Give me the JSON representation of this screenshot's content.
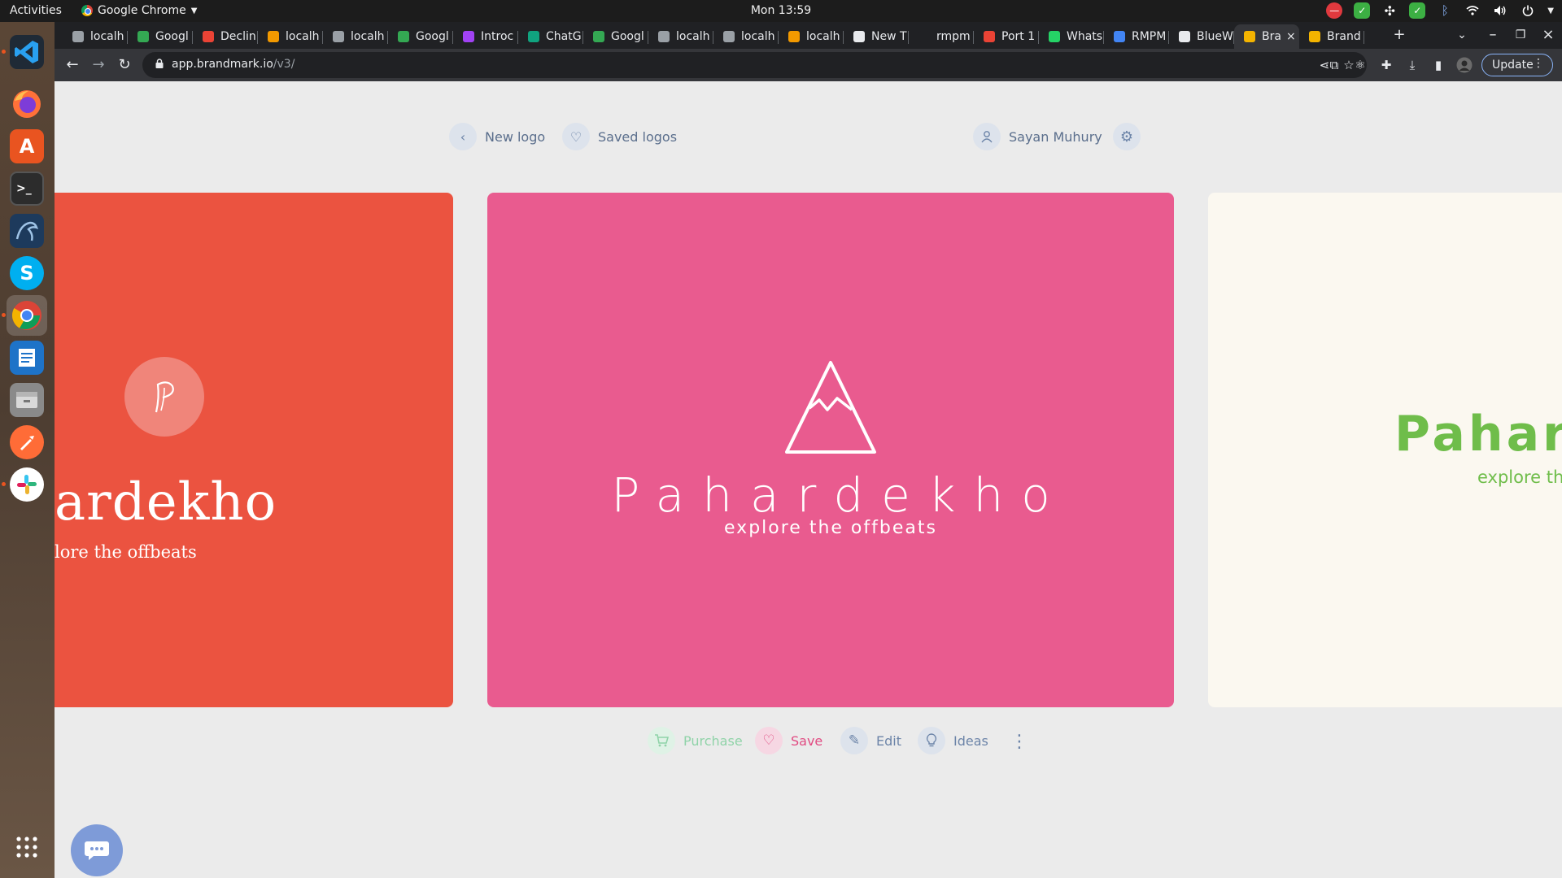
{
  "topbar": {
    "activities": "Activities",
    "app_name": "Google Chrome",
    "clock": "Mon 13:59"
  },
  "dock": {
    "apps": [
      "vscode-icon",
      "firefox-icon",
      "software-center-icon",
      "terminal-icon",
      "mysql-workbench-icon",
      "skype-icon",
      "chrome-icon",
      "writer-icon",
      "files-icon",
      "postman-icon",
      "slack-icon",
      "show-apps-icon"
    ]
  },
  "tabs": [
    {
      "label": "localh",
      "color": "#9aa0a6"
    },
    {
      "label": "Googl",
      "color": "#34a853"
    },
    {
      "label": "Declin",
      "color": "#ea4335"
    },
    {
      "label": "localh",
      "color": "#f29900"
    },
    {
      "label": "localh",
      "color": "#9aa0a6"
    },
    {
      "label": "Googl",
      "color": "#34a853"
    },
    {
      "label": "Introc",
      "color": "#a142f4"
    },
    {
      "label": "ChatG",
      "color": "#10a37f"
    },
    {
      "label": "Googl",
      "color": "#34a853"
    },
    {
      "label": "localh",
      "color": "#9aa0a6"
    },
    {
      "label": "localh",
      "color": "#9aa0a6"
    },
    {
      "label": "localh",
      "color": "#f29900"
    },
    {
      "label": "New T",
      "color": "#e8eaed"
    },
    {
      "label": "rmpm",
      "color": "#202124"
    },
    {
      "label": "Port 1",
      "color": "#ea4335"
    },
    {
      "label": "Whats",
      "color": "#25d366"
    },
    {
      "label": "RMPM",
      "color": "#4285f4"
    },
    {
      "label": "BlueW",
      "color": "#e8eaed"
    },
    {
      "label": "Bra",
      "color": "#f4b400",
      "active": true
    },
    {
      "label": "Brand",
      "color": "#f4b400"
    }
  ],
  "toolbar": {
    "url_host": "app.brandmark.io",
    "url_path": "/v3/",
    "update_label": "Update"
  },
  "page": {
    "nav": {
      "new_logo": "New logo",
      "saved_logos": "Saved logos",
      "user_name": "Sayan Muhury"
    },
    "cards": {
      "left": {
        "brand": "ardekho",
        "tagline": "lore the offbeats",
        "color": "#eb5340"
      },
      "center": {
        "brand": "Pahardekho",
        "tagline": "explore the offbeats",
        "color": "#e95b8f"
      },
      "right": {
        "brand": "Pahar",
        "tagline": "explore the",
        "color": "#6fbd4a"
      }
    },
    "actions": {
      "purchase": "Purchase",
      "save": "Save",
      "edit": "Edit",
      "ideas": "Ideas"
    }
  }
}
